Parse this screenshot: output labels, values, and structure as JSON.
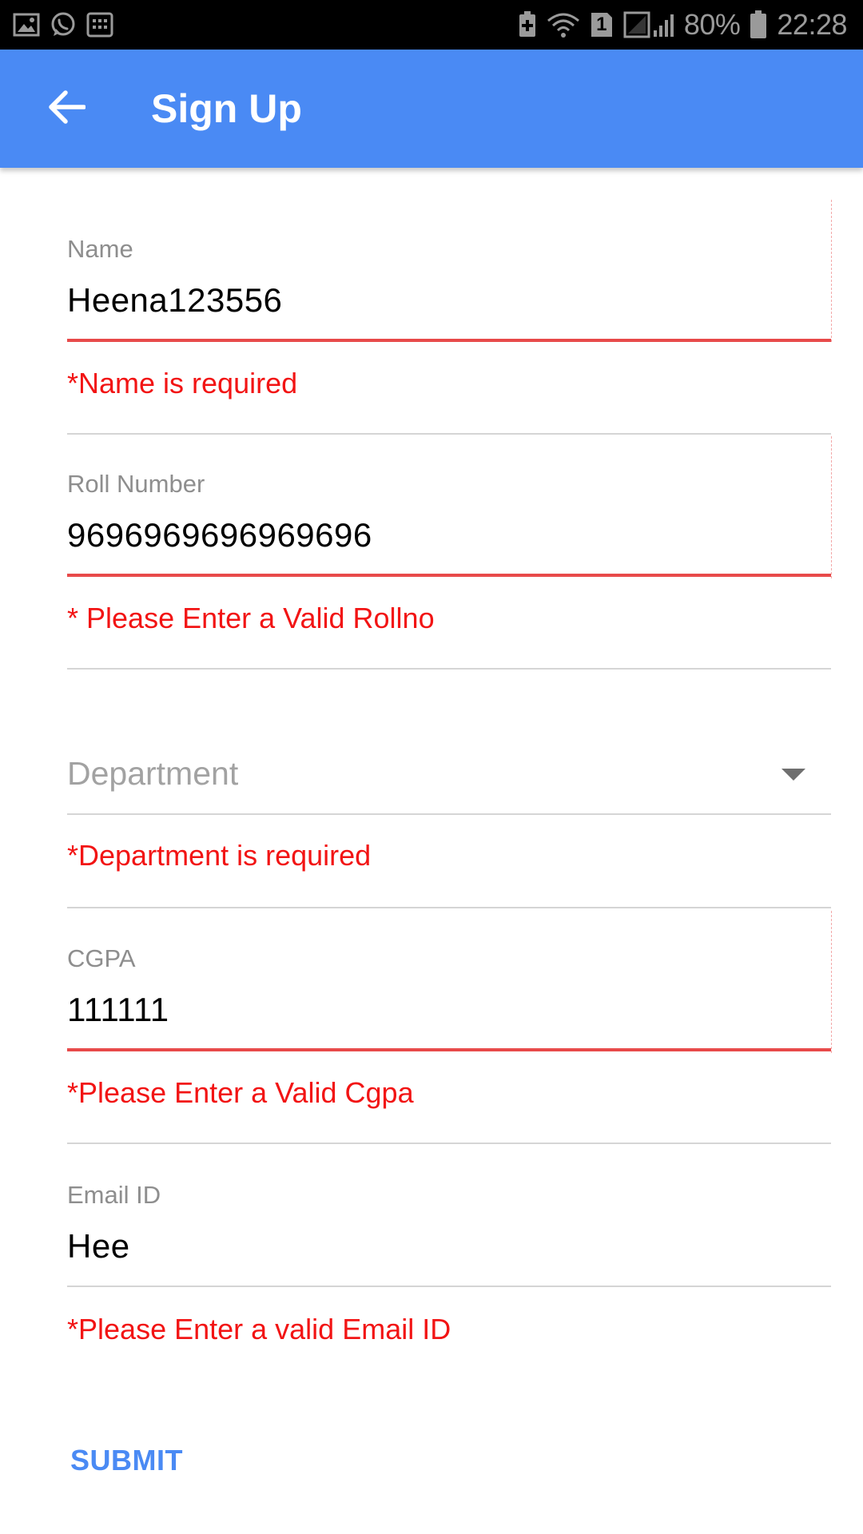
{
  "status_bar": {
    "battery": "80%",
    "time": "22:28",
    "sim_slot": "1"
  },
  "app_bar": {
    "title": "Sign Up"
  },
  "form": {
    "name": {
      "label": "Name",
      "value": "Heena123556",
      "error": "*Name is required"
    },
    "roll_number": {
      "label": "Roll Number",
      "value": "9696969696969696",
      "error": "* Please Enter a Valid Rollno"
    },
    "department": {
      "placeholder": "Department",
      "error": "*Department is required"
    },
    "cgpa": {
      "label": "CGPA",
      "value": "111111",
      "error": "*Please Enter a Valid Cgpa"
    },
    "email": {
      "label": "Email ID",
      "value": "Hee",
      "error": "*Please Enter a valid Email ID"
    }
  },
  "submit_label": "SUBMIT",
  "colors": {
    "app_bar": "#4a8af4",
    "error": "#f21414",
    "error_underline": "#e84a4a",
    "label": "#8e8e8e"
  }
}
